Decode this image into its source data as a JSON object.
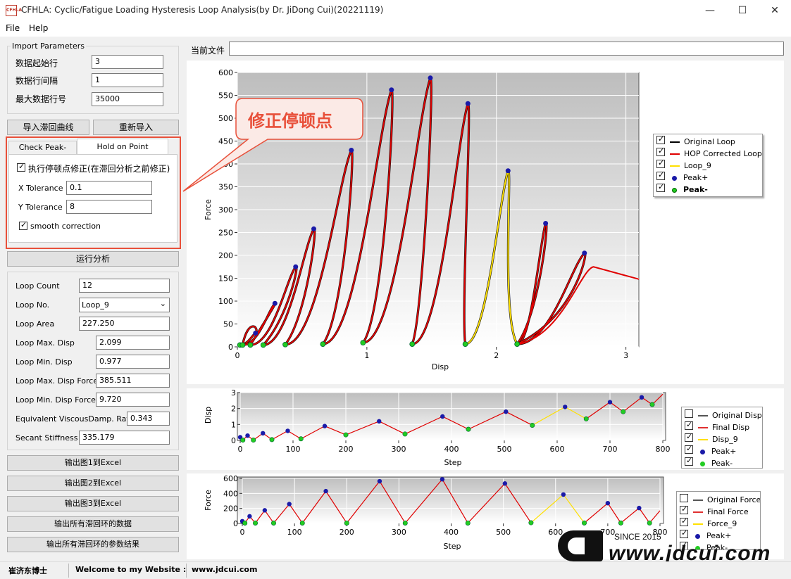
{
  "window": {
    "title": "CFHLA: Cyclic/Fatigue Loading Hysteresis Loop Analysis(by Dr. JiDong Cui)(20221119)",
    "icon_text": "CFHLA"
  },
  "menu": [
    "File",
    "Help"
  ],
  "import_params": {
    "title": "Import Parameters",
    "rows": [
      {
        "label": "数据起始行",
        "value": "3"
      },
      {
        "label": "数据行间隔",
        "value": "1"
      },
      {
        "label": "最大数据行号",
        "value": "35000"
      }
    ]
  },
  "buttons": {
    "import": "导入滞回曲线",
    "reimport": "重新导入",
    "run": "运行分析",
    "export": [
      "输出图1到Excel",
      "输出图2到Excel",
      "输出图3到Excel",
      "输出所有滞回环的数据",
      "输出所有滞回环的参数结果"
    ]
  },
  "tabs": [
    "Check Peak-Force",
    "Hold on Point Correction"
  ],
  "hop": {
    "enable_label": "执行停顿点修正(在滞回分析之前修正)",
    "x_tol_label": "X Tolerance",
    "x_tol": "0.1",
    "y_tol_label": "Y Tolerance",
    "y_tol": "8",
    "smooth_label": "smooth correction"
  },
  "results": {
    "loop_count_label": "Loop Count",
    "loop_count": "12",
    "loop_no_label": "Loop No.",
    "loop_no": "Loop_9",
    "rows": [
      {
        "label": "Loop Area",
        "value": "227.250"
      },
      {
        "label": "Loop Max. Disp",
        "value": "2.099"
      },
      {
        "label": "Loop Min. Disp",
        "value": "0.977"
      },
      {
        "label": "Loop Max. Disp Force",
        "value": "385.511"
      },
      {
        "label": "Loop Min. Disp Force",
        "value": "9.720"
      },
      {
        "label": "Equivalent ViscousDamp. Ratio",
        "value": "0.343"
      },
      {
        "label": "Secant Stiffness Ed",
        "value": "335.179"
      }
    ]
  },
  "current_file_label": "当前文件",
  "current_file_value": "",
  "callout": "修正停顿点",
  "status": {
    "author": "崔济东博士",
    "welcome": "Welcome to my Website :",
    "url": "www.jdcui.com"
  },
  "watermark": {
    "since": "SINCE 2015",
    "url": "www.jdcui.com"
  },
  "colors": {
    "accent_red": "#e8503a",
    "curve_red": "#e00000",
    "curve_yellow": "#ffe000",
    "peak_plus": "#1a1aa8",
    "peak_minus": "#22cc22"
  },
  "chart_data": [
    {
      "type": "line",
      "title": "",
      "xlabel": "Disp",
      "ylabel": "Force",
      "xlim": [
        0,
        3.1
      ],
      "ylim": [
        0,
        600
      ],
      "xticks": [
        "0",
        "1",
        "2",
        "3"
      ],
      "yticks": [
        "0",
        "50",
        "100",
        "150",
        "200",
        "250",
        "300",
        "350",
        "400",
        "450",
        "500",
        "550",
        "600"
      ],
      "legend": [
        "Original Loop",
        "HOP Corrected Loop",
        "Loop_9",
        "Peak+",
        "Peak-"
      ],
      "peaks_plus": [
        [
          0.14,
          30
        ],
        [
          0.29,
          95
        ],
        [
          0.45,
          175
        ],
        [
          0.59,
          258
        ],
        [
          0.88,
          430
        ],
        [
          1.19,
          562
        ],
        [
          1.49,
          588
        ],
        [
          1.78,
          532
        ],
        [
          2.09,
          385
        ],
        [
          2.38,
          270
        ],
        [
          2.68,
          205
        ]
      ],
      "peaks_minus": [
        [
          0.02,
          4
        ],
        [
          0.04,
          4
        ],
        [
          0.1,
          4
        ],
        [
          0.2,
          4
        ],
        [
          0.37,
          5
        ],
        [
          0.66,
          6
        ],
        [
          0.97,
          9
        ],
        [
          1.35,
          6
        ],
        [
          1.76,
          6
        ],
        [
          2.16,
          6
        ]
      ]
    },
    {
      "type": "line",
      "xlabel": "Step",
      "ylabel": "Disp",
      "xlim": [
        0,
        800
      ],
      "ylim": [
        0,
        3
      ],
      "xticks": [
        "0",
        "100",
        "200",
        "300",
        "400",
        "500",
        "600",
        "700",
        "800"
      ],
      "yticks": [
        "0",
        "1",
        "2",
        "3"
      ],
      "legend": [
        "Original Disp",
        "Final Disp",
        "Disp_9",
        "Peak+",
        "Peak-"
      ],
      "x": [
        0,
        5,
        14,
        25,
        43,
        60,
        90,
        115,
        160,
        200,
        263,
        312,
        383,
        432,
        503,
        553,
        615,
        655,
        700,
        725,
        760,
        780,
        800
      ],
      "values": [
        0.2,
        0.02,
        0.3,
        0.02,
        0.45,
        0.05,
        0.6,
        0.1,
        0.9,
        0.35,
        1.2,
        0.4,
        1.5,
        0.7,
        1.8,
        0.95,
        2.1,
        1.35,
        2.4,
        1.8,
        2.7,
        2.25,
        2.9
      ]
    },
    {
      "type": "line",
      "xlabel": "Step",
      "ylabel": "Force",
      "xlim": [
        0,
        800
      ],
      "ylim": [
        0,
        600
      ],
      "xticks": [
        "0",
        "100",
        "200",
        "300",
        "400",
        "500",
        "600",
        "700",
        "800"
      ],
      "yticks": [
        "0",
        "200",
        "400",
        "600"
      ],
      "legend": [
        "Original Force",
        "Final Force",
        "Force_9",
        "Peak+",
        "Peak-"
      ],
      "x": [
        0,
        5,
        14,
        25,
        43,
        60,
        90,
        115,
        160,
        200,
        263,
        312,
        383,
        432,
        503,
        553,
        615,
        655,
        700,
        725,
        760,
        780,
        800
      ],
      "values": [
        30,
        5,
        95,
        5,
        175,
        5,
        258,
        5,
        430,
        5,
        562,
        5,
        588,
        5,
        532,
        9,
        385,
        6,
        270,
        6,
        205,
        6,
        170
      ]
    }
  ]
}
